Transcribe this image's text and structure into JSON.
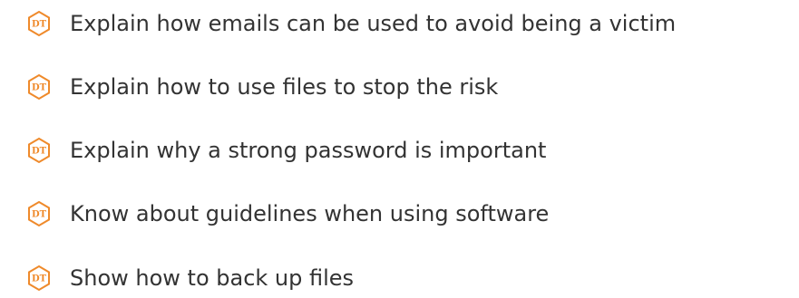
{
  "objectives": [
    {
      "badge": "DT",
      "text": "Explain how emails can be used to avoid being a victim",
      "icon": "dt-hexagon-badge-icon"
    },
    {
      "badge": "DT",
      "text": "Explain how to use files to stop the risk",
      "icon": "dt-hexagon-badge-icon"
    },
    {
      "badge": "DT",
      "text": "Explain why a strong password is important",
      "icon": "dt-hexagon-badge-icon"
    },
    {
      "badge": "DT",
      "text": "Know about guidelines when using software",
      "icon": "dt-hexagon-badge-icon"
    },
    {
      "badge": "DT",
      "text": "Show how to back up files",
      "icon": "dt-hexagon-badge-icon"
    }
  ],
  "colors": {
    "badge_accent": "#ef8a2b",
    "text": "#333333",
    "background": "#ffffff"
  }
}
